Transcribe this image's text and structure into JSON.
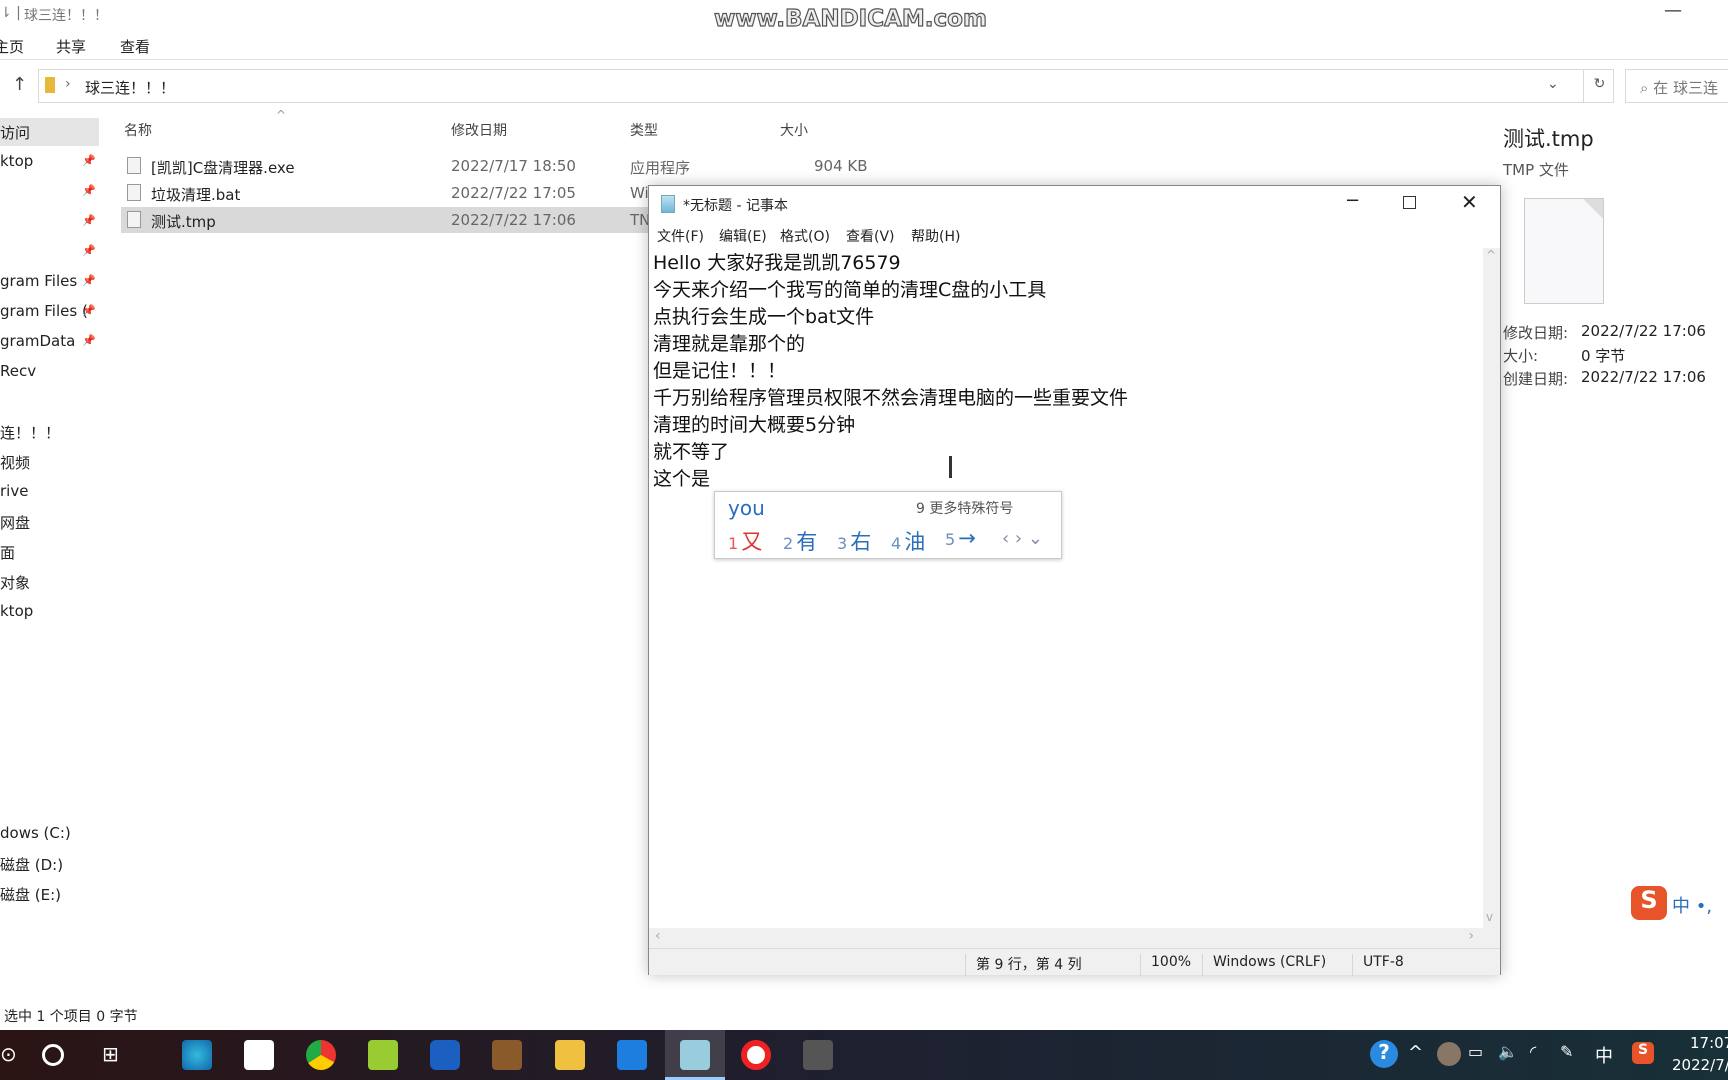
{
  "explorer": {
    "title": "球三连！！！",
    "ribbon": [
      "主页",
      "共享",
      "查看"
    ],
    "address": "球三连！！！",
    "search_placeholder": "在 球三连",
    "columns": [
      "名称",
      "修改日期",
      "类型",
      "大小"
    ],
    "files": [
      {
        "name": "[凯凯]C盘清理器.exe",
        "date": "2022/7/17 18:50",
        "type": "应用程序",
        "size": "904 KB"
      },
      {
        "name": "垃圾清理.bat",
        "date": "2022/7/22 17:05",
        "type": "Wi",
        "size": ""
      },
      {
        "name": "测试.tmp",
        "date": "2022/7/22 17:06",
        "type": "TN",
        "size": "",
        "selected": true
      }
    ],
    "nav": [
      "访问",
      "ktop",
      "",
      "",
      "",
      "gram Files",
      "gram Files (",
      "gramData",
      "Recv",
      "",
      "连！！！",
      "视频",
      "rive",
      "网盘",
      "面",
      "对象",
      "ktop"
    ],
    "drives": [
      "dows (C:)",
      "磁盘 (D:)",
      "磁盘 (E:)"
    ],
    "status": "选中 1 个项目  0 字节",
    "details": {
      "title": "测试.tmp",
      "type": "TMP 文件",
      "fields": [
        {
          "label": "修改日期:",
          "value": "2022/7/22 17:06"
        },
        {
          "label": "大小:",
          "value": "0 字节"
        },
        {
          "label": "创建日期:",
          "value": "2022/7/22 17:06"
        }
      ]
    }
  },
  "watermark": "www.BANDICAM.com",
  "notepad": {
    "title": "*无标题 - 记事本",
    "menu": [
      "文件(F)",
      "编辑(E)",
      "格式(O)",
      "查看(V)",
      "帮助(H)"
    ],
    "lines": [
      "Hello 大家好我是凯凯76579",
      "今天来介绍一个我写的简单的清理C盘的小工具",
      "点执行会生成一个bat文件",
      "清理就是靠那个的",
      "但是记住！！！",
      "千万别给程序管理员权限不然会清理电脑的一些重要文件",
      "清理的时间大概要5分钟",
      "就不等了",
      "这个是"
    ],
    "status": {
      "position": "第 9 行，第 4 列",
      "zoom": "100%",
      "eol": "Windows (CRLF)",
      "encoding": "UTF-8"
    }
  },
  "ime": {
    "input": "you",
    "more": "9 更多特殊符号",
    "candidates": [
      {
        "n": "1",
        "c": "又"
      },
      {
        "n": "2",
        "c": "有"
      },
      {
        "n": "3",
        "c": "右"
      },
      {
        "n": "4",
        "c": "油"
      },
      {
        "n": "5",
        "c": "→"
      }
    ]
  },
  "sogou_bar": "中 •,",
  "tray": {
    "ime": "中",
    "time": "17:07",
    "date": "2022/7/"
  }
}
